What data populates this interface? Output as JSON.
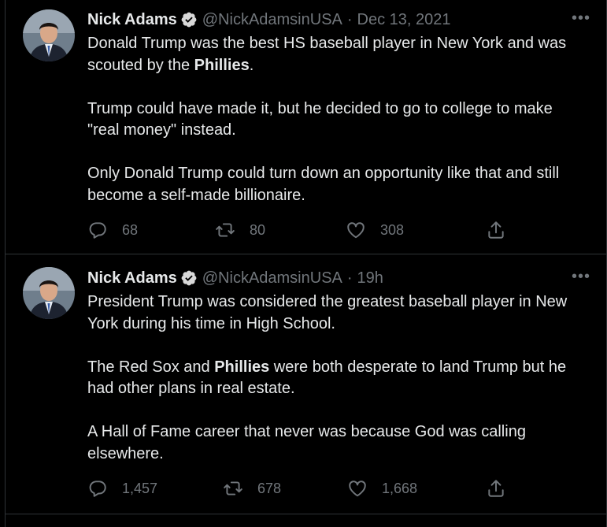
{
  "tweets": [
    {
      "name": "Nick Adams",
      "handle": "@NickAdamsinUSA",
      "separator": "·",
      "time": "Dec 13, 2021",
      "more": "•••",
      "paragraphs": [
        [
          {
            "text": "Donald Trump was the best HS baseball player in New York and was scouted by the ",
            "bold": false
          },
          {
            "text": "Phillies",
            "bold": true
          },
          {
            "text": ".",
            "bold": false
          }
        ],
        [
          {
            "text": "Trump could have made it, but he decided to go to college to make \"real money\" instead.",
            "bold": false
          }
        ],
        [
          {
            "text": "Only Donald Trump could turn down an opportunity like that and still become a self-made billionaire.",
            "bold": false
          }
        ]
      ],
      "replies": "68",
      "retweets": "80",
      "likes": "308"
    },
    {
      "name": "Nick Adams",
      "handle": "@NickAdamsinUSA",
      "separator": "·",
      "time": "19h",
      "more": "•••",
      "paragraphs": [
        [
          {
            "text": "President Trump was considered the greatest baseball player in New York during his time in High School.",
            "bold": false
          }
        ],
        [
          {
            "text": "The Red Sox and ",
            "bold": false
          },
          {
            "text": "Phillies",
            "bold": true
          },
          {
            "text": " were both desperate to land Trump but he had other plans in real estate.",
            "bold": false
          }
        ],
        [
          {
            "text": "A Hall of Fame career that never was because God was calling elsewhere.",
            "bold": false
          }
        ]
      ],
      "replies": "1,457",
      "retweets": "678",
      "likes": "1,668"
    }
  ],
  "colors": {
    "background": "#000000",
    "text": "#e7e9ea",
    "secondary": "#71767b",
    "border": "#2f3336",
    "verified": "#d8d8d8"
  },
  "icons": [
    "verified-badge-icon",
    "more-icon",
    "reply-icon",
    "retweet-icon",
    "like-icon",
    "share-icon"
  ]
}
